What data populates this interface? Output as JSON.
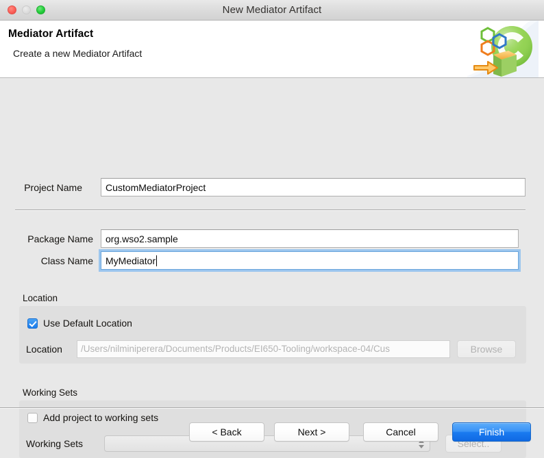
{
  "window": {
    "title": "New Mediator Artifact",
    "traffic_lights": [
      "close",
      "minimize",
      "maximize"
    ]
  },
  "header": {
    "title": "Mediator Artifact",
    "subtitle": "Create a new Mediator Artifact",
    "icon": "mediator-artifact-wizard-icon"
  },
  "form": {
    "project_name": {
      "label": "Project Name",
      "value": "CustomMediatorProject",
      "placeholder": ""
    },
    "package_name": {
      "label": "Package Name",
      "value": "org.wso2.sample",
      "placeholder": ""
    },
    "class_name": {
      "label": "Class Name",
      "value": "MyMediator",
      "placeholder": "",
      "focused": true
    }
  },
  "location_group": {
    "legend": "Location",
    "use_default_checkbox": {
      "label": "Use Default Location",
      "checked": true
    },
    "location_field": {
      "label": "Location",
      "value": "/Users/nilminiperera/Documents/Products/EI650-Tooling/workspace-04/Cus",
      "disabled": true
    },
    "browse_button": {
      "label": "Browse",
      "disabled": true
    }
  },
  "working_sets_group": {
    "legend": "Working Sets",
    "add_checkbox": {
      "label": "Add project to working sets",
      "checked": false
    },
    "working_sets_combo": {
      "label": "Working Sets",
      "value": "",
      "options": [],
      "disabled": true
    },
    "select_button": {
      "label": "Select..",
      "disabled": true
    }
  },
  "footer": {
    "back_button": {
      "label": "< Back",
      "disabled": false
    },
    "next_button": {
      "label": "Next >",
      "disabled": false
    },
    "cancel_button": {
      "label": "Cancel",
      "disabled": false
    },
    "finish_button": {
      "label": "Finish",
      "disabled": false,
      "default": true
    }
  },
  "colors": {
    "window_background": "#e8e8e8",
    "header_background": "#ffffff",
    "group_background": "#dfdfdf",
    "accent_blue": "#1a7bf0",
    "focus_ring": "#9cc6ee",
    "close_light": "#fc5f58",
    "minimize_light": "#dcdcdc",
    "maximize_light": "#23cc3b"
  }
}
